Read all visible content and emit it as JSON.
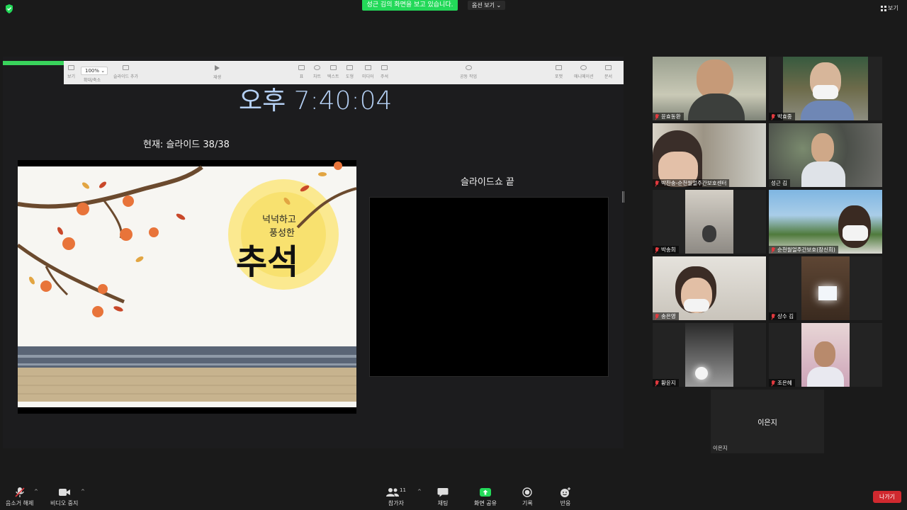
{
  "top": {
    "share_banner": "성근 김의 화면을 보고 있습니다.",
    "view_options": "옵션 보기",
    "view_button": "보기",
    "shield_color": "#23d959"
  },
  "keynote": {
    "zoom": "100%",
    "toolbar_items": [
      "보기",
      "확대/축소",
      "슬라이드 추가",
      "재생",
      "표",
      "차트",
      "텍스트",
      "도형",
      "미디어",
      "주석",
      "공동 작업",
      "포맷",
      "애니메이션",
      "문서"
    ]
  },
  "presenter": {
    "clock": "오후 7:40:04",
    "current_label": "현재: 슬라이드 38/38",
    "next_label": "슬라이드쇼 끝",
    "slide_title_line1": "넉넉하고",
    "slide_title_line2": "풍성한",
    "slide_title_main": "추석"
  },
  "participants": [
    {
      "name": "윤효동환",
      "muted": true
    },
    {
      "name": "박효중",
      "muted": true
    },
    {
      "name": "박찬송-순천월얼주간보호센터",
      "muted": true
    },
    {
      "name": "성근 김",
      "muted": false,
      "active": true
    },
    {
      "name": "박송희",
      "muted": true
    },
    {
      "name": "순천월얼주간보호(장신희)",
      "muted": true
    },
    {
      "name": "송은영",
      "muted": true
    },
    {
      "name": "상수 김",
      "muted": true
    },
    {
      "name": "황윤지",
      "muted": true
    },
    {
      "name": "조은혜",
      "muted": true
    },
    {
      "name": "이은지",
      "muted": false
    }
  ],
  "toolbar": {
    "mute": "음소거 해제",
    "video": "비디오 중지",
    "participants": "참가자",
    "participants_count": "11",
    "chat": "채팅",
    "share": "화면 공유",
    "record": "기록",
    "reactions": "반응",
    "leave": "나가기"
  }
}
